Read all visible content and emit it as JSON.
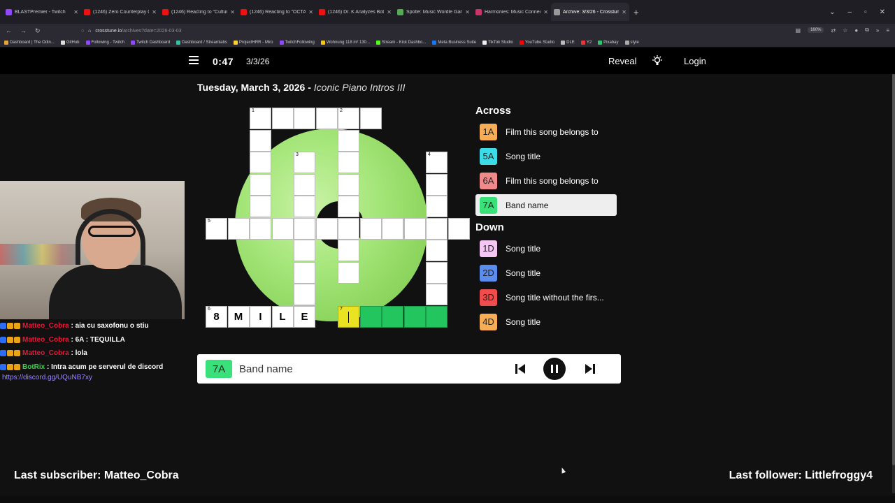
{
  "browser": {
    "tabs": [
      {
        "title": "BLASTPremier - Twitch",
        "color": "#9146ff",
        "active": false
      },
      {
        "title": "(1246) Zero Counterplay Onesh",
        "color": "#e11",
        "active": false
      },
      {
        "title": "(1246) Reacting to \"Culture\" by",
        "color": "#e11",
        "active": false
      },
      {
        "title": "(1246) Reacting to \"OCTANE\" b",
        "color": "#e11",
        "active": false
      },
      {
        "title": "(1246) Dr. K Analyzes Bobby Le",
        "color": "#e11",
        "active": false
      },
      {
        "title": "Spotle: Music Wordle Game",
        "color": "#5a5",
        "active": false
      },
      {
        "title": "Harmonies: Music Connection",
        "color": "#c36",
        "active": false
      },
      {
        "title": "Archive: 3/3/26 - Crosstune",
        "color": "#999",
        "active": true
      }
    ],
    "url_host": "crosstune.io",
    "url_path": "/archives?date=2026-03-03",
    "zoom": "160%",
    "bookmarks": [
      {
        "label": "Dashboard | The Odin...",
        "color": "#e9a23b"
      },
      {
        "label": "GitHub",
        "color": "#ddd"
      },
      {
        "label": "Following - Twitch",
        "color": "#9146ff"
      },
      {
        "label": "Twitch Dashboard",
        "color": "#9146ff"
      },
      {
        "label": "Dashboard / Streamlabs",
        "color": "#31c3a2"
      },
      {
        "label": "ProjectHRR - Miro",
        "color": "#ffd02f"
      },
      {
        "label": "TwitchFollowing",
        "color": "#9146ff"
      },
      {
        "label": "Wohnung 118 m² 130...",
        "color": "#f5c518"
      },
      {
        "label": "Stream - Kick Dashbo...",
        "color": "#53fc18"
      },
      {
        "label": "Meta Business Suite",
        "color": "#1877f2"
      },
      {
        "label": "TikTok Studio",
        "color": "#eee"
      },
      {
        "label": "YouTube Studio",
        "color": "#f00"
      },
      {
        "label": "DLE",
        "color": "#bbb"
      },
      {
        "label": "Y2",
        "color": "#e33"
      },
      {
        "label": "Pixabay",
        "color": "#2ec66d"
      },
      {
        "label": "style",
        "color": "#aaa"
      }
    ]
  },
  "header": {
    "timer": "0:47",
    "date": "3/3/26",
    "reveal": "Reveal",
    "login": "Login"
  },
  "puzzle": {
    "date_title": "Tuesday, March 3, 2026",
    "separator": " - ",
    "theme": "Iconic Piano Intros III"
  },
  "clues": {
    "across_label": "Across",
    "down_label": "Down",
    "across": [
      {
        "id": "1A",
        "text": "Film this song belongs to",
        "color": "#f6ad55",
        "active": false
      },
      {
        "id": "5A",
        "text": "Song title",
        "color": "#3ddbe8",
        "active": false
      },
      {
        "id": "6A",
        "text": "Film this song belongs to",
        "color": "#f08a8a",
        "active": false
      },
      {
        "id": "7A",
        "text": "Band name",
        "color": "#3ae07a",
        "active": true
      }
    ],
    "down": [
      {
        "id": "1D",
        "text": "Song title",
        "color": "#f4c6f4",
        "active": false
      },
      {
        "id": "2D",
        "text": "Song title",
        "color": "#5b8def",
        "active": false
      },
      {
        "id": "3D",
        "text": "Song title without the firs...",
        "color": "#ef4d4d",
        "active": false
      },
      {
        "id": "4D",
        "text": "Song title",
        "color": "#f6ad55",
        "active": false
      }
    ]
  },
  "player": {
    "clue_id": "7A",
    "clue_text": "Band name"
  },
  "grid_cells": [
    {
      "r": 0,
      "c": 2,
      "num": "1",
      "letter": "",
      "state": ""
    },
    {
      "r": 0,
      "c": 3,
      "num": "",
      "letter": "",
      "state": ""
    },
    {
      "r": 0,
      "c": 4,
      "num": "",
      "letter": "",
      "state": ""
    },
    {
      "r": 0,
      "c": 5,
      "num": "",
      "letter": "",
      "state": ""
    },
    {
      "r": 0,
      "c": 6,
      "num": "2",
      "letter": "",
      "state": ""
    },
    {
      "r": 0,
      "c": 7,
      "num": "",
      "letter": "",
      "state": ""
    },
    {
      "r": 1,
      "c": 2,
      "num": "",
      "letter": "",
      "state": ""
    },
    {
      "r": 1,
      "c": 6,
      "num": "",
      "letter": "",
      "state": ""
    },
    {
      "r": 2,
      "c": 2,
      "num": "",
      "letter": "",
      "state": ""
    },
    {
      "r": 2,
      "c": 4,
      "num": "3",
      "letter": "",
      "state": ""
    },
    {
      "r": 2,
      "c": 6,
      "num": "",
      "letter": "",
      "state": ""
    },
    {
      "r": 2,
      "c": 10,
      "num": "4",
      "letter": "",
      "state": ""
    },
    {
      "r": 3,
      "c": 2,
      "num": "",
      "letter": "",
      "state": ""
    },
    {
      "r": 3,
      "c": 4,
      "num": "",
      "letter": "",
      "state": ""
    },
    {
      "r": 3,
      "c": 6,
      "num": "",
      "letter": "",
      "state": ""
    },
    {
      "r": 3,
      "c": 10,
      "num": "",
      "letter": "",
      "state": ""
    },
    {
      "r": 4,
      "c": 2,
      "num": "",
      "letter": "",
      "state": ""
    },
    {
      "r": 4,
      "c": 4,
      "num": "",
      "letter": "",
      "state": ""
    },
    {
      "r": 4,
      "c": 6,
      "num": "",
      "letter": "",
      "state": ""
    },
    {
      "r": 4,
      "c": 10,
      "num": "",
      "letter": "",
      "state": ""
    },
    {
      "r": 5,
      "c": 0,
      "num": "5",
      "letter": "",
      "state": ""
    },
    {
      "r": 5,
      "c": 1,
      "num": "",
      "letter": "",
      "state": ""
    },
    {
      "r": 5,
      "c": 2,
      "num": "",
      "letter": "",
      "state": ""
    },
    {
      "r": 5,
      "c": 3,
      "num": "",
      "letter": "",
      "state": ""
    },
    {
      "r": 5,
      "c": 4,
      "num": "",
      "letter": "",
      "state": ""
    },
    {
      "r": 5,
      "c": 5,
      "num": "",
      "letter": "",
      "state": ""
    },
    {
      "r": 5,
      "c": 6,
      "num": "",
      "letter": "",
      "state": ""
    },
    {
      "r": 5,
      "c": 7,
      "num": "",
      "letter": "",
      "state": ""
    },
    {
      "r": 5,
      "c": 8,
      "num": "",
      "letter": "",
      "state": ""
    },
    {
      "r": 5,
      "c": 9,
      "num": "",
      "letter": "",
      "state": ""
    },
    {
      "r": 5,
      "c": 10,
      "num": "",
      "letter": "",
      "state": ""
    },
    {
      "r": 5,
      "c": 11,
      "num": "",
      "letter": "",
      "state": ""
    },
    {
      "r": 6,
      "c": 4,
      "num": "",
      "letter": "",
      "state": ""
    },
    {
      "r": 6,
      "c": 6,
      "num": "",
      "letter": "",
      "state": ""
    },
    {
      "r": 6,
      "c": 10,
      "num": "",
      "letter": "",
      "state": ""
    },
    {
      "r": 7,
      "c": 4,
      "num": "",
      "letter": "",
      "state": ""
    },
    {
      "r": 7,
      "c": 6,
      "num": "",
      "letter": "",
      "state": ""
    },
    {
      "r": 7,
      "c": 10,
      "num": "",
      "letter": "",
      "state": ""
    },
    {
      "r": 8,
      "c": 4,
      "num": "",
      "letter": "",
      "state": ""
    },
    {
      "r": 8,
      "c": 10,
      "num": "",
      "letter": "",
      "state": ""
    },
    {
      "r": 9,
      "c": 0,
      "num": "6",
      "letter": "8",
      "state": ""
    },
    {
      "r": 9,
      "c": 1,
      "num": "",
      "letter": "M",
      "state": ""
    },
    {
      "r": 9,
      "c": 2,
      "num": "",
      "letter": "I",
      "state": ""
    },
    {
      "r": 9,
      "c": 3,
      "num": "",
      "letter": "L",
      "state": ""
    },
    {
      "r": 9,
      "c": 4,
      "num": "",
      "letter": "E",
      "state": ""
    },
    {
      "r": 9,
      "c": 6,
      "num": "7",
      "letter": "",
      "state": "cur"
    },
    {
      "r": 9,
      "c": 7,
      "num": "",
      "letter": "",
      "state": "hl"
    },
    {
      "r": 9,
      "c": 8,
      "num": "",
      "letter": "",
      "state": "hl"
    },
    {
      "r": 9,
      "c": 9,
      "num": "",
      "letter": "",
      "state": "hl"
    },
    {
      "r": 9,
      "c": 10,
      "num": "",
      "letter": "",
      "state": "hl"
    }
  ],
  "chat": [
    {
      "user": "Matteo_Cobra",
      "user_color": "#e8153a",
      "msg": "aia cu saxofonu o stiu"
    },
    {
      "user": "Matteo_Cobra",
      "user_color": "#e8153a",
      "msg": "6A : TEQUILLA"
    },
    {
      "user": "Matteo_Cobra",
      "user_color": "#e8153a",
      "msg": "lola"
    },
    {
      "user": "BotRix",
      "user_color": "#3ad14a",
      "msg": "Intra acum pe serverul de discord"
    }
  ],
  "chat_link": "https://discord.gg/UQuNB7xy",
  "overlay": {
    "last_subscriber": "Last subscriber: Matteo_Cobra",
    "last_follower": "Last follower: Littlefroggy4"
  }
}
